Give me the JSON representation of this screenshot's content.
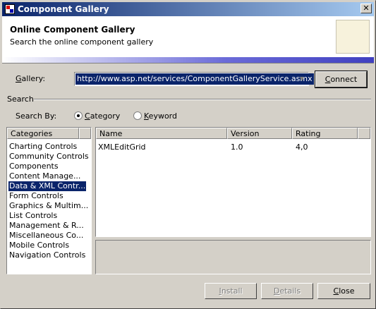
{
  "window": {
    "title": "Component Gallery",
    "close_glyph": "✕"
  },
  "header": {
    "title": "Online Component Gallery",
    "subtitle": "Search the online component gallery"
  },
  "gallery": {
    "label": "Gallery:",
    "url": "http://www.asp.net/services/ComponentGalleryService.asmx",
    "connect_label": "Connect"
  },
  "search": {
    "group_label": "Search",
    "by_label": "Search By:",
    "options": [
      {
        "label": "Category",
        "selected": true
      },
      {
        "label": "Keyword",
        "selected": false
      }
    ]
  },
  "categories": {
    "header": "Categories",
    "items": [
      "Charting Controls",
      "Community Controls",
      "Components",
      "Content Manage...",
      "Data & XML Contr...",
      "Form Controls",
      "Graphics & Multim...",
      "List Controls",
      "Management & R...",
      "Miscellaneous Co...",
      "Mobile Controls",
      "Navigation Controls"
    ],
    "selected_index": 4
  },
  "results": {
    "columns": [
      "Name",
      "Version",
      "Rating"
    ],
    "rows": [
      {
        "name": "XMLEditGrid",
        "version": "1.0",
        "rating": "4,0"
      }
    ]
  },
  "buttons": {
    "install": "Install",
    "details": "Details",
    "close": "Close"
  },
  "colors": {
    "selection": "#0a246a",
    "title_gradient_start": "#0a246a",
    "title_gradient_end": "#a6caf0",
    "face": "#d4d0c8"
  },
  "icons": {
    "app": "component-gallery-app-icon",
    "close": "close-icon",
    "dropdown": "chevron-down-icon"
  }
}
